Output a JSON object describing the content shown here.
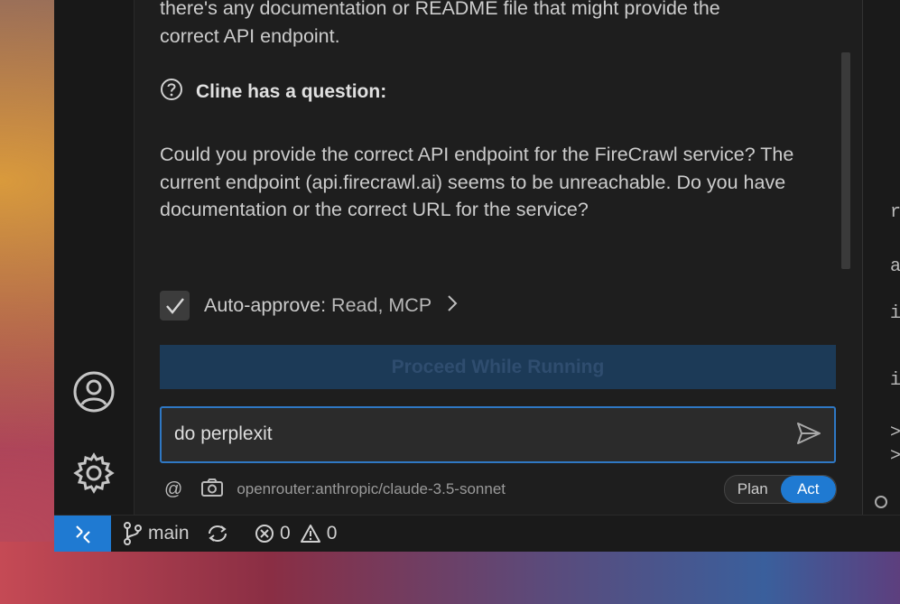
{
  "message": {
    "partial_line_1": "there's any documentation or README file that might provide the",
    "partial_line_2": "correct API endpoint."
  },
  "question": {
    "icon": "help-circle-icon",
    "title": "Cline has a question:",
    "body": "Could you provide the correct API endpoint for the FireCrawl service? The current endpoint (api.firecrawl.ai) seems to be unreachable. Do you have documentation or the correct URL for the service?"
  },
  "auto_approve": {
    "checked": true,
    "label": "Auto-approve:",
    "value": "Read, MCP"
  },
  "proceed_button": {
    "label": "Proceed While Running"
  },
  "chat": {
    "input_value": "do perplexit"
  },
  "footer": {
    "mention_symbol": "@",
    "model": "openrouter:anthropic/claude-3.5-sonnet",
    "mode_plan": "Plan",
    "mode_act": "Act",
    "active_mode": "Act"
  },
  "status_bar": {
    "branch": "main",
    "errors": "0",
    "warnings": "0"
  },
  "colors": {
    "accent": "#1f7ad2",
    "input_border": "#2f78c4",
    "proceed_bg": "#1c3a57"
  }
}
